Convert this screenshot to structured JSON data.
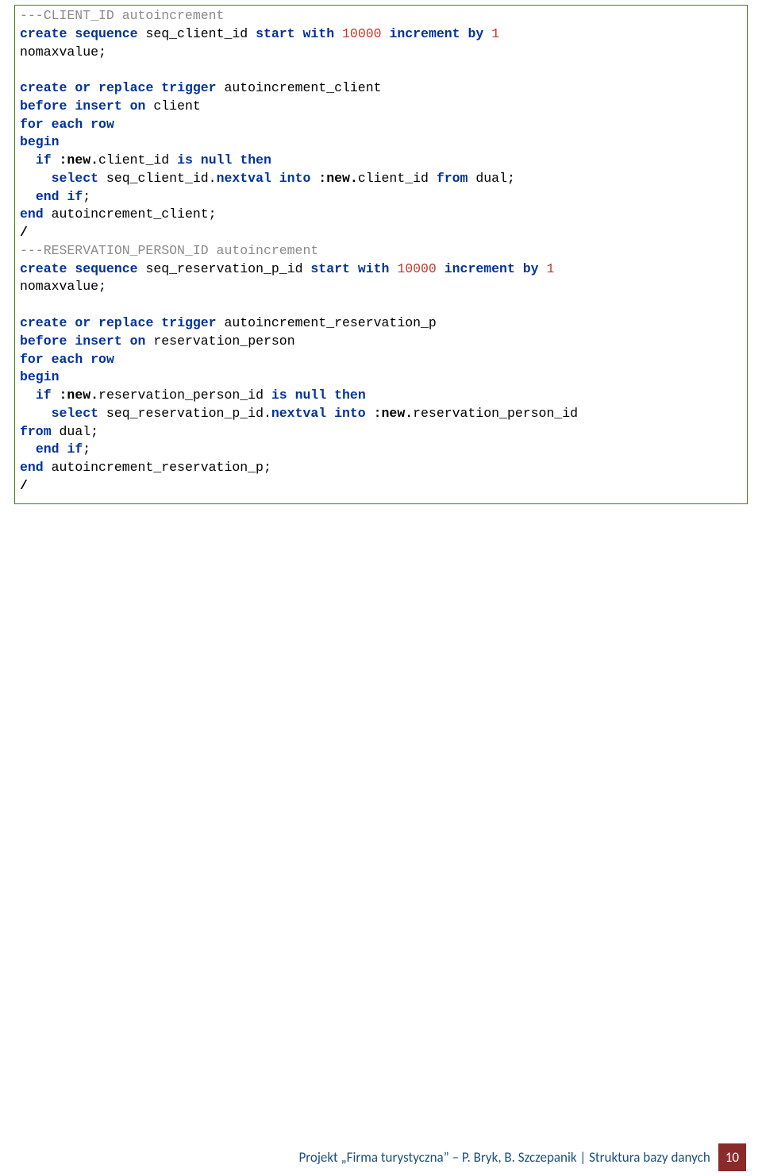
{
  "code": {
    "lines": [
      [
        [
          "comment",
          "---CLIENT_ID autoincrement"
        ]
      ],
      [
        [
          "kw",
          "create"
        ],
        [
          "plain",
          " "
        ],
        [
          "kw",
          "sequence"
        ],
        [
          "plain",
          " seq_client_id "
        ],
        [
          "kw",
          "start"
        ],
        [
          "plain",
          " "
        ],
        [
          "kw",
          "with"
        ],
        [
          "plain",
          " "
        ],
        [
          "num",
          "10000"
        ],
        [
          "plain",
          " "
        ],
        [
          "kw",
          "increment"
        ],
        [
          "plain",
          " "
        ],
        [
          "kw",
          "by"
        ],
        [
          "plain",
          " "
        ],
        [
          "num",
          "1"
        ]
      ],
      [
        [
          "plain",
          "nomaxvalue;"
        ]
      ],
      [
        [
          "plain",
          ""
        ]
      ],
      [
        [
          "kw",
          "create"
        ],
        [
          "plain",
          " "
        ],
        [
          "kw",
          "or"
        ],
        [
          "plain",
          " "
        ],
        [
          "kw",
          "replace"
        ],
        [
          "plain",
          " "
        ],
        [
          "kw",
          "trigger"
        ],
        [
          "plain",
          " autoincrement_client"
        ]
      ],
      [
        [
          "kw",
          "before"
        ],
        [
          "plain",
          " "
        ],
        [
          "kw",
          "insert"
        ],
        [
          "plain",
          " "
        ],
        [
          "kw",
          "on"
        ],
        [
          "plain",
          " client"
        ]
      ],
      [
        [
          "kw",
          "for"
        ],
        [
          "plain",
          " "
        ],
        [
          "kw",
          "each"
        ],
        [
          "plain",
          " "
        ],
        [
          "kw",
          "row"
        ]
      ],
      [
        [
          "kw",
          "begin"
        ]
      ],
      [
        [
          "plain",
          "  "
        ],
        [
          "kw",
          "if"
        ],
        [
          "plain",
          " "
        ],
        [
          "bold",
          ":new."
        ],
        [
          "plain",
          "client_id "
        ],
        [
          "kw",
          "is"
        ],
        [
          "plain",
          " "
        ],
        [
          "kw",
          "null"
        ],
        [
          "plain",
          " "
        ],
        [
          "kw",
          "then"
        ]
      ],
      [
        [
          "plain",
          "    "
        ],
        [
          "kw",
          "select"
        ],
        [
          "plain",
          " seq_client_id."
        ],
        [
          "kw",
          "nextval"
        ],
        [
          "plain",
          " "
        ],
        [
          "kw",
          "into"
        ],
        [
          "plain",
          " "
        ],
        [
          "bold",
          ":new."
        ],
        [
          "plain",
          "client_id "
        ],
        [
          "kw",
          "from"
        ],
        [
          "plain",
          " dual;"
        ]
      ],
      [
        [
          "plain",
          "  "
        ],
        [
          "kw",
          "end"
        ],
        [
          "plain",
          " "
        ],
        [
          "kw",
          "if"
        ],
        [
          "plain",
          ";"
        ]
      ],
      [
        [
          "kw",
          "end"
        ],
        [
          "plain",
          " autoincrement_client;"
        ]
      ],
      [
        [
          "bold",
          "/"
        ]
      ],
      [
        [
          "comment",
          "---RESERVATION_PERSON_ID autoincrement"
        ]
      ],
      [
        [
          "kw",
          "create"
        ],
        [
          "plain",
          " "
        ],
        [
          "kw",
          "sequence"
        ],
        [
          "plain",
          " seq_reservation_p_id "
        ],
        [
          "kw",
          "start"
        ],
        [
          "plain",
          " "
        ],
        [
          "kw",
          "with"
        ],
        [
          "plain",
          " "
        ],
        [
          "num",
          "10000"
        ],
        [
          "plain",
          " "
        ],
        [
          "kw",
          "increment"
        ],
        [
          "plain",
          " "
        ],
        [
          "kw",
          "by"
        ],
        [
          "plain",
          " "
        ],
        [
          "num",
          "1"
        ]
      ],
      [
        [
          "plain",
          "nomaxvalue;"
        ]
      ],
      [
        [
          "plain",
          ""
        ]
      ],
      [
        [
          "kw",
          "create"
        ],
        [
          "plain",
          " "
        ],
        [
          "kw",
          "or"
        ],
        [
          "plain",
          " "
        ],
        [
          "kw",
          "replace"
        ],
        [
          "plain",
          " "
        ],
        [
          "kw",
          "trigger"
        ],
        [
          "plain",
          " autoincrement_reservation_p"
        ]
      ],
      [
        [
          "kw",
          "before"
        ],
        [
          "plain",
          " "
        ],
        [
          "kw",
          "insert"
        ],
        [
          "plain",
          " "
        ],
        [
          "kw",
          "on"
        ],
        [
          "plain",
          " reservation_person"
        ]
      ],
      [
        [
          "kw",
          "for"
        ],
        [
          "plain",
          " "
        ],
        [
          "kw",
          "each"
        ],
        [
          "plain",
          " "
        ],
        [
          "kw",
          "row"
        ]
      ],
      [
        [
          "kw",
          "begin"
        ]
      ],
      [
        [
          "plain",
          "  "
        ],
        [
          "kw",
          "if"
        ],
        [
          "plain",
          " "
        ],
        [
          "bold",
          ":new."
        ],
        [
          "plain",
          "reservation_person_id "
        ],
        [
          "kw",
          "is"
        ],
        [
          "plain",
          " "
        ],
        [
          "kw",
          "null"
        ],
        [
          "plain",
          " "
        ],
        [
          "kw",
          "then"
        ]
      ],
      [
        [
          "plain",
          "    "
        ],
        [
          "kw",
          "select"
        ],
        [
          "plain",
          " seq_reservation_p_id."
        ],
        [
          "kw",
          "nextval"
        ],
        [
          "plain",
          " "
        ],
        [
          "kw",
          "into"
        ],
        [
          "plain",
          " "
        ],
        [
          "bold",
          ":new."
        ],
        [
          "plain",
          "reservation_person_id"
        ]
      ],
      [
        [
          "kw",
          "from"
        ],
        [
          "plain",
          " dual;"
        ]
      ],
      [
        [
          "plain",
          "  "
        ],
        [
          "kw",
          "end"
        ],
        [
          "plain",
          " "
        ],
        [
          "kw",
          "if"
        ],
        [
          "plain",
          ";"
        ]
      ],
      [
        [
          "kw",
          "end"
        ],
        [
          "plain",
          " autoincrement_reservation_p;"
        ]
      ],
      [
        [
          "bold",
          "/"
        ]
      ]
    ]
  },
  "footer": {
    "text": "Projekt „Firma turystyczna” – P. Bryk, B. Szczepanik | Struktura bazy danych",
    "page": "10"
  }
}
